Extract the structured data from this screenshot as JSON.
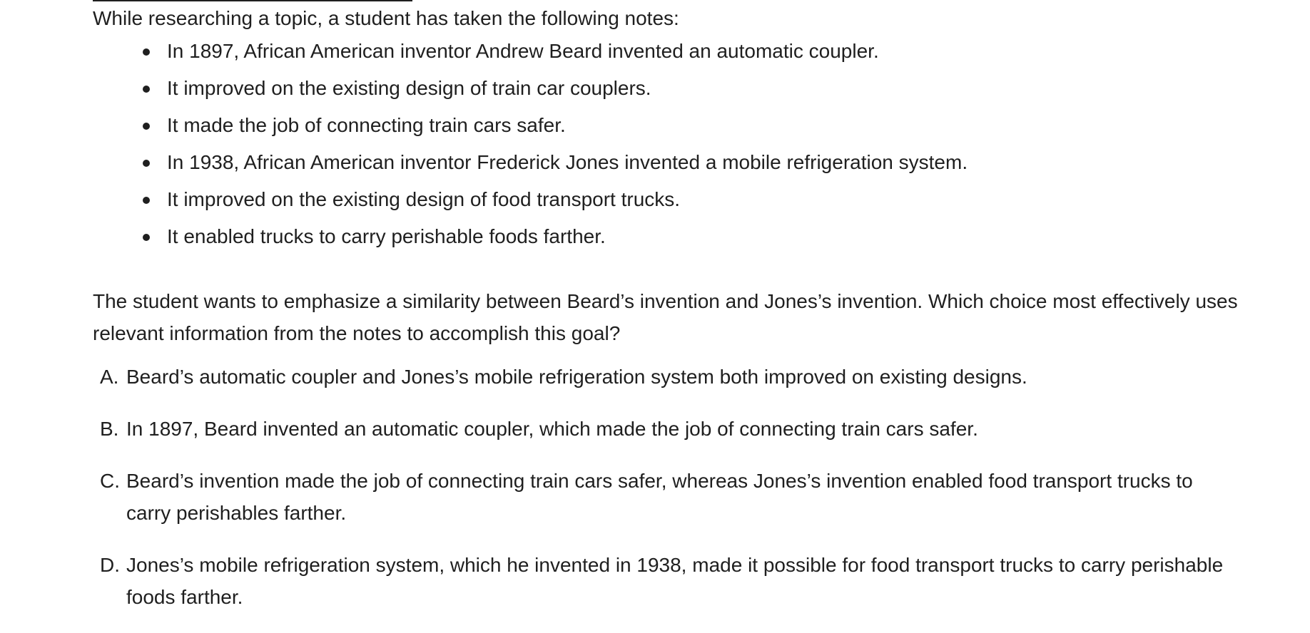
{
  "intro": "While researching a topic, a student has taken the following notes:",
  "notes": [
    "In 1897, African American inventor Andrew Beard invented an automatic coupler.",
    "It improved on the existing design of train car couplers.",
    "It made the job of connecting train cars safer.",
    "In 1938, African American inventor Frederick Jones invented a mobile refrigeration system.",
    "It improved on the existing design of food transport trucks.",
    "It enabled trucks to carry perishable foods farther."
  ],
  "question": "The student wants to emphasize a similarity between Beard’s invention and Jones’s invention. Which choice most effectively uses relevant information from the notes to accomplish this goal?",
  "choices": [
    {
      "letter": "A.",
      "text": "Beard’s automatic coupler and Jones’s mobile refrigeration system both improved on existing designs."
    },
    {
      "letter": "B.",
      "text": "In 1897, Beard invented an automatic coupler, which made the job of connecting train cars safer."
    },
    {
      "letter": "C.",
      "text": "Beard’s invention made the job of connecting train cars safer, whereas Jones’s invention enabled food transport trucks to carry perishables farther."
    },
    {
      "letter": "D.",
      "text": "Jones’s mobile refrigeration system, which he invented in 1938, made it possible for food transport trucks to carry perishable foods farther."
    }
  ]
}
